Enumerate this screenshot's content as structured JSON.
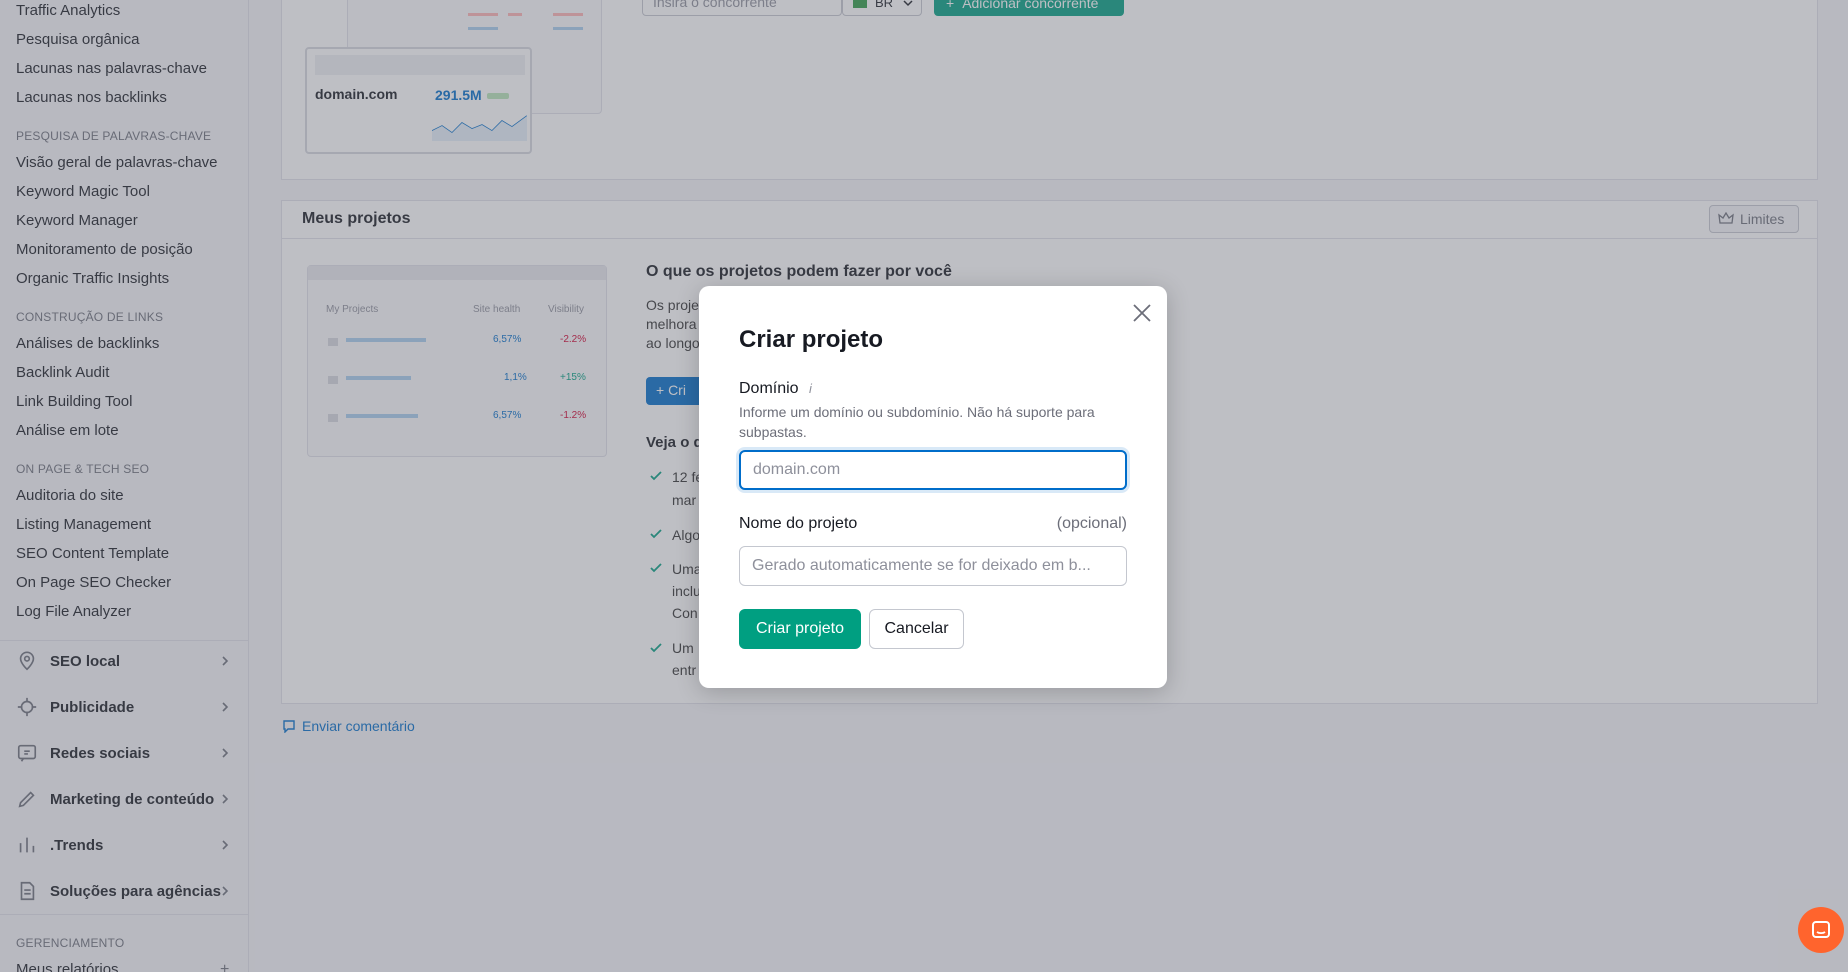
{
  "sidebar": {
    "top_links": [
      "Traffic Analytics",
      "Pesquisa orgânica",
      "Lacunas nas palavras-chave",
      "Lacunas nos backlinks"
    ],
    "sections": [
      {
        "title": "PESQUISA DE PALAVRAS-CHAVE",
        "links": [
          "Visão geral de palavras-chave",
          "Keyword Magic Tool",
          "Keyword Manager",
          "Monitoramento de posição",
          "Organic Traffic Insights"
        ]
      },
      {
        "title": "CONSTRUÇÃO DE LINKS",
        "links": [
          "Análises de backlinks",
          "Backlink Audit",
          "Link Building Tool",
          "Análise em lote"
        ]
      },
      {
        "title": "ON PAGE & TECH SEO",
        "links": [
          "Auditoria do site",
          "Listing Management",
          "SEO Content Template",
          "On Page SEO Checker",
          "Log File Analyzer"
        ]
      }
    ],
    "categories": [
      {
        "label": "SEO local",
        "icon": "location-pin-icon"
      },
      {
        "label": "Publicidade",
        "icon": "crosshair-icon"
      },
      {
        "label": "Redes sociais",
        "icon": "social-chat-icon"
      },
      {
        "label": "Marketing de conteúdo",
        "icon": "pencil-icon"
      },
      {
        "label": ".Trends",
        "icon": "bar-chart-icon"
      },
      {
        "label": "Soluções para agências",
        "icon": "document-icon"
      }
    ],
    "management_title": "GERENCIAMENTO",
    "management_first": "Meus relatórios"
  },
  "competitor_bar": {
    "placeholder": "Insira o concorrente",
    "country": "BR",
    "add_button": "Adicionar concorrente"
  },
  "illustration": {
    "domain": "domain.com",
    "value": "291.5M"
  },
  "projects": {
    "heading": "Meus projetos",
    "limits_button": "Limites",
    "table_headers": [
      "My Projects",
      "Site health",
      "Visibility"
    ],
    "table_rows": [
      {
        "health": "6,57%",
        "visibility": "-2.2%"
      },
      {
        "health": "1,1%",
        "visibility": "+15%"
      },
      {
        "health": "6,57%",
        "visibility": "-1.2%"
      }
    ],
    "promo_title": "O que os projetos podem fazer por você",
    "promo_text_fragments": [
      "Os proje",
      "melhora",
      "ao longo"
    ],
    "create_button_fragment": "+ Cri",
    "see_fragment": "Veja o q",
    "checklist_fragments": [
      [
        "12 fe",
        "mar"
      ],
      [
        "Algo"
      ],
      [
        "Uma",
        "inclu",
        "Con"
      ],
      [
        "Um",
        "entr"
      ]
    ]
  },
  "feedback_link": "Enviar comentário",
  "modal": {
    "title": "Criar projeto",
    "domain_label": "Domínio",
    "domain_info_icon": "i",
    "domain_hint": "Informe um domínio ou subdomínio. Não há suporte para subpastas.",
    "domain_placeholder": "domain.com",
    "name_label": "Nome do projeto",
    "name_optional": "(opcional)",
    "name_placeholder": "Gerado automaticamente se for deixado em b...",
    "create_button": "Criar projeto",
    "cancel_button": "Cancelar"
  },
  "colors": {
    "primary_green": "#009f81",
    "link_blue": "#006dca",
    "chat_orange": "#ff642d"
  }
}
